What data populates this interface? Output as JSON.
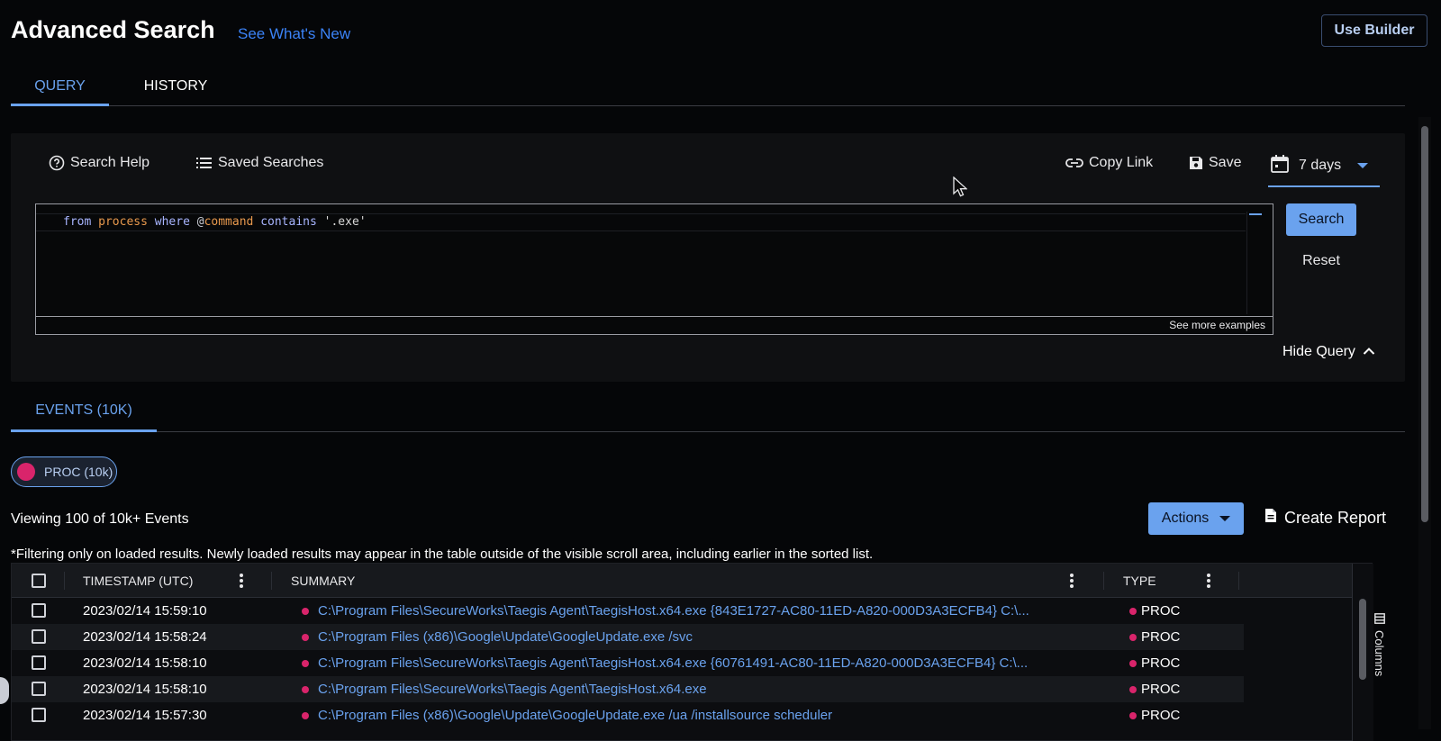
{
  "header": {
    "title": "Advanced Search",
    "whats_new": "See What's New",
    "use_builder": "Use Builder"
  },
  "tabs": [
    {
      "label": "QUERY",
      "active": true
    },
    {
      "label": "HISTORY",
      "active": false
    }
  ],
  "query_panel": {
    "search_help": "Search Help",
    "saved_searches": "Saved Searches",
    "copy_link": "Copy Link",
    "save": "Save",
    "date_range": "7 days",
    "query_tokens": {
      "from": "from",
      "table": "process",
      "where": "where",
      "at": "@",
      "field": "command",
      "op": "contains",
      "value": "'.exe'"
    },
    "see_more": "See more examples",
    "search_button": "Search",
    "reset_button": "Reset",
    "hide_query": "Hide Query"
  },
  "events": {
    "tab_label": "EVENTS (10K)",
    "chip_label": "PROC (10k)",
    "viewing": "Viewing 100 of 10k+ Events",
    "actions": "Actions",
    "create_report": "Create Report",
    "filter_note": "*Filtering only on loaded results.  Newly loaded results may appear in the table outside of the visible scroll area, including earlier in the sorted list.",
    "columns_label": "Columns"
  },
  "table": {
    "headers": {
      "timestamp": "TIMESTAMP (UTC)",
      "summary": "SUMMARY",
      "type": "TYPE"
    },
    "rows": [
      {
        "timestamp": "2023/02/14 15:59:10",
        "summary": "C:\\Program Files\\SecureWorks\\Taegis Agent\\TaegisHost.x64.exe {843E1727-AC80-11ED-A820-000D3A3ECFB4} C:\\...",
        "type": "PROC"
      },
      {
        "timestamp": "2023/02/14 15:58:24",
        "summary": "C:\\Program Files (x86)\\Google\\Update\\GoogleUpdate.exe /svc",
        "type": "PROC"
      },
      {
        "timestamp": "2023/02/14 15:58:10",
        "summary": "C:\\Program Files\\SecureWorks\\Taegis Agent\\TaegisHost.x64.exe {60761491-AC80-11ED-A820-000D3A3ECFB4} C:\\...",
        "type": "PROC"
      },
      {
        "timestamp": "2023/02/14 15:58:10",
        "summary": "C:\\Program Files\\SecureWorks\\Taegis Agent\\TaegisHost.x64.exe",
        "type": "PROC"
      },
      {
        "timestamp": "2023/02/14 15:57:30",
        "summary": "C:\\Program Files (x86)\\Google\\Update\\GoogleUpdate.exe /ua /installsource scheduler",
        "type": "PROC"
      }
    ]
  },
  "colors": {
    "accent": "#6aa2ee",
    "link": "#3b82f6",
    "proc_dot": "#d9246b",
    "background": "#050608"
  },
  "icons": [
    "help-circle-icon",
    "list-icon",
    "link-icon",
    "floppy-disk-icon",
    "calendar-icon",
    "chevron-down-icon",
    "chevron-up-icon",
    "document-icon",
    "columns-icon",
    "kebab-menu-icon",
    "mouse-cursor-icon"
  ]
}
